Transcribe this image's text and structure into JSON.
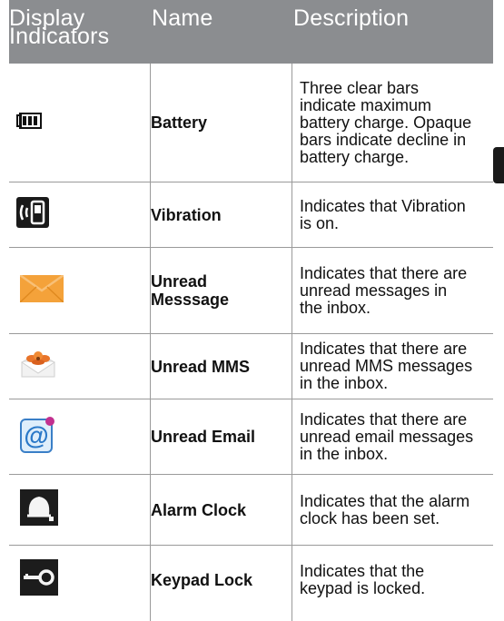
{
  "header": {
    "col1": "Display\nIndicators",
    "col2": "Name",
    "col3": "Description"
  },
  "rows": [
    {
      "icon": "battery-icon",
      "name": "Battery",
      "description": "Three clear bars\nindicate maximum\nbattery charge. Opaque\nbars indicate decline in\nbattery charge."
    },
    {
      "icon": "vibration-icon",
      "name": "Vibration",
      "description": "Indicates that Vibration\nis on."
    },
    {
      "icon": "unread-message-icon",
      "name": "Unread\nMesssage",
      "description": "Indicates that there are\nunread messages in\nthe inbox."
    },
    {
      "icon": "unread-mms-icon",
      "name": "Unread MMS",
      "description": "Indicates that there are\nunread MMS messages\nin the inbox."
    },
    {
      "icon": "unread-email-icon",
      "name": "Unread Email",
      "description": "Indicates that there are\nunread email messages\nin the inbox."
    },
    {
      "icon": "alarm-clock-icon",
      "name": "Alarm Clock",
      "description": "Indicates that the alarm\nclock has been set."
    },
    {
      "icon": "keypad-lock-icon",
      "name": "Keypad Lock",
      "description": "Indicates that the\nkeypad is locked."
    }
  ]
}
